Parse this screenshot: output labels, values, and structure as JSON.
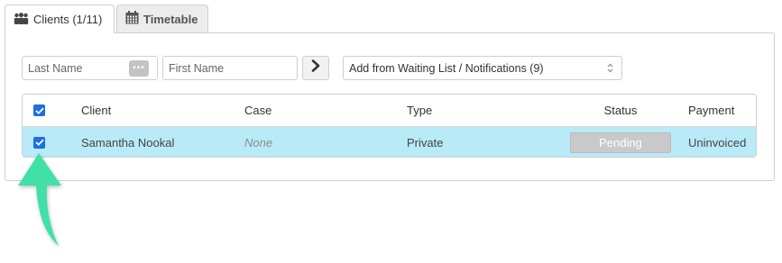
{
  "tabs": [
    {
      "label": "Clients (1/11)",
      "icon": "people-icon",
      "active": true
    },
    {
      "label": "Timetable",
      "icon": "calendar-icon",
      "active": false
    }
  ],
  "filters": {
    "last_name_placeholder": "Last Name",
    "first_name_placeholder": "First Name",
    "more_button_label": "•••",
    "waitlist_select": "Add from Waiting List / Notifications (9)"
  },
  "table": {
    "headers": {
      "client": "Client",
      "case": "Case",
      "type": "Type",
      "status": "Status",
      "payment": "Payment"
    },
    "rows": [
      {
        "checked": true,
        "client": "Samantha Nookal",
        "case": "None",
        "type": "Private",
        "status": "Pending",
        "payment": "Uninvoiced"
      }
    ]
  },
  "colors": {
    "selected_row": "#b9eaf8",
    "checkbox": "#1e6fe0",
    "arrow": "#3fe0a8",
    "status_badge": "#c9c9c9"
  }
}
